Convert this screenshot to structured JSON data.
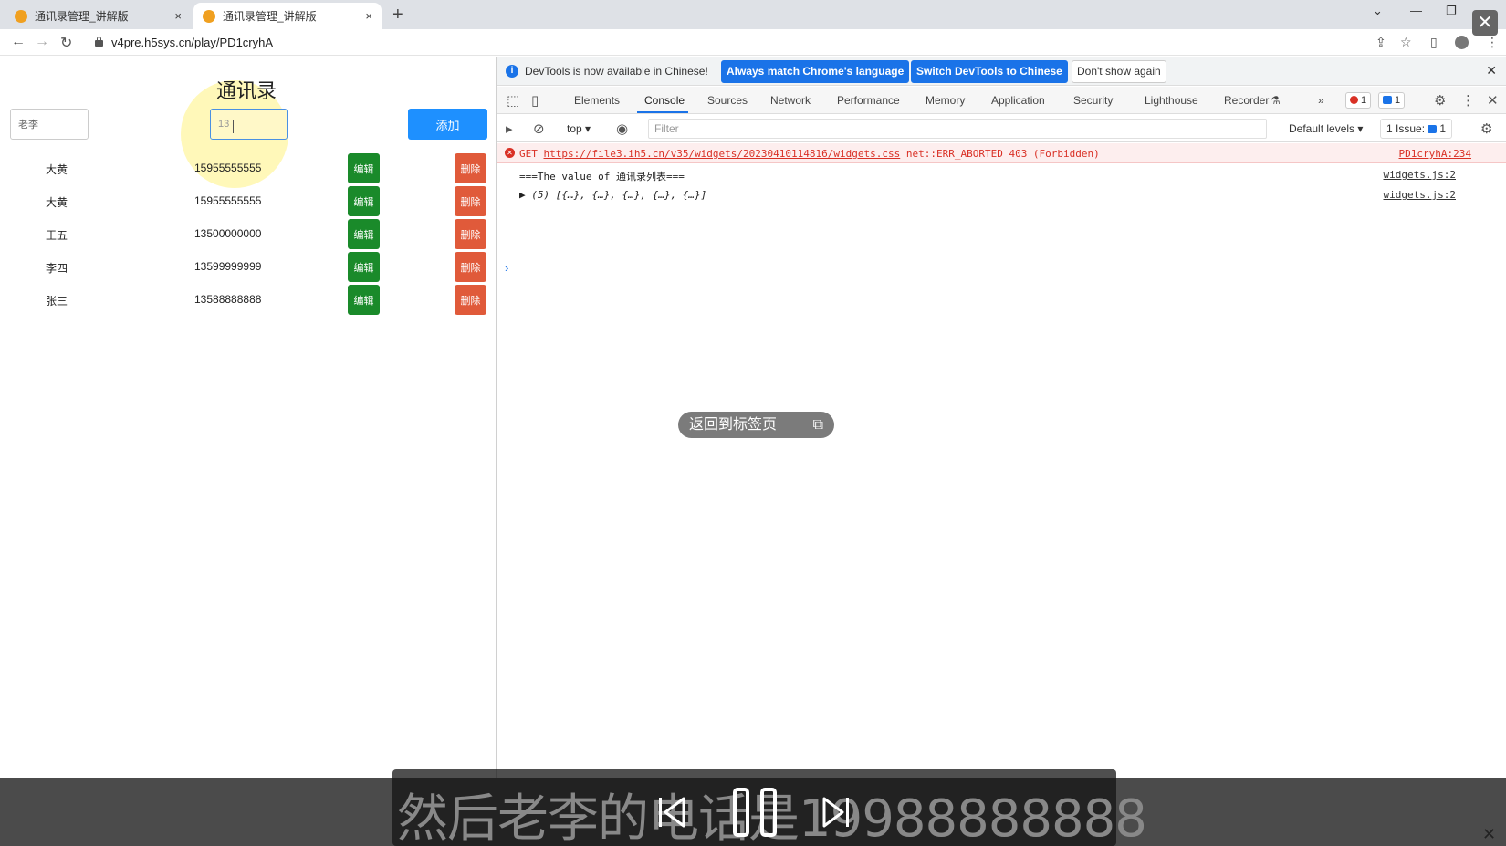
{
  "browser": {
    "tabs": [
      {
        "title": "通讯录管理_讲解版",
        "close": "×"
      },
      {
        "title": "通讯录管理_讲解版",
        "close": "×"
      }
    ],
    "new_tab": "+",
    "url": "v4pre.h5sys.cn/play/PD1cryhA"
  },
  "page": {
    "title": "通讯录",
    "name_input_value": "老李",
    "phone_input_value": "13",
    "add_button": "添加",
    "contacts": [
      {
        "name": "大黄",
        "phone": "15955555555",
        "edit": "编辑",
        "delete": "删除"
      },
      {
        "name": "大黄",
        "phone": "15955555555",
        "edit": "编辑",
        "delete": "删除"
      },
      {
        "name": "王五",
        "phone": "13500000000",
        "edit": "编辑",
        "delete": "删除"
      },
      {
        "name": "李四",
        "phone": "13599999999",
        "edit": "编辑",
        "delete": "删除"
      },
      {
        "name": "张三",
        "phone": "13588888888",
        "edit": "编辑",
        "delete": "删除"
      }
    ]
  },
  "devtools": {
    "infobar": {
      "text": "DevTools is now available in Chinese!",
      "btn_match": "Always match Chrome's language",
      "btn_switch": "Switch DevTools to Chinese",
      "btn_dont": "Don't show again"
    },
    "tabs": [
      "Elements",
      "Console",
      "Sources",
      "Network",
      "Performance",
      "Memory",
      "Application",
      "Security",
      "Lighthouse",
      "Recorder"
    ],
    "active_tab": "Console",
    "more": "»",
    "error_count": "1",
    "message_count": "1",
    "context": "top",
    "filter_placeholder": "Filter",
    "levels": "Default levels",
    "issues_label": "1 Issue:",
    "issues_count": "1",
    "console": {
      "error": {
        "method": "GET",
        "url": "https://file3.ih5.cn/v35/widgets/20230410114816/widgets.css",
        "status": "net::ERR_ABORTED 403 (Forbidden)",
        "source": "PD1cryhA:234"
      },
      "log1": {
        "text": "===The value of 通讯录列表===",
        "source": "widgets.js:2"
      },
      "log2": {
        "text": "▶ (5) [{…}, {…}, {…}, {…}, {…}]",
        "source": "widgets.js:2"
      },
      "prompt": "›"
    }
  },
  "overlay": {
    "back_to_tab": "返回到标签页",
    "subtitle": "然后老李的电话是19988888888"
  },
  "colors": {
    "add_button": "#1e90ff",
    "edit_button": "#1a8a2a",
    "delete_button": "#e05a3a",
    "devtools_primary": "#1a73e8",
    "error_red": "#d93025"
  }
}
